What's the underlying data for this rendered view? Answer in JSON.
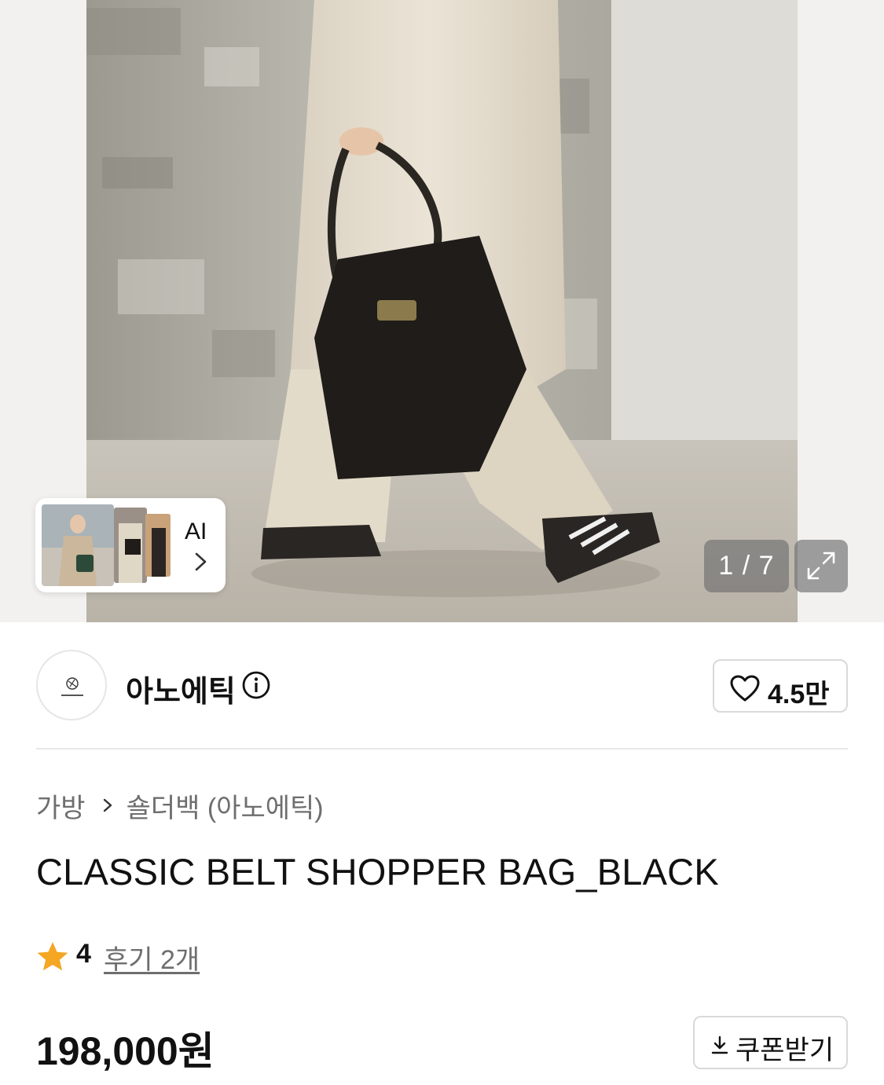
{
  "gallery": {
    "page_current": "1",
    "page_total": "7",
    "page_counter": "1 / 7",
    "thumbnail_label": "AI",
    "icons": {
      "chevron": "chevron-right-icon",
      "expand": "expand-icon"
    }
  },
  "brand": {
    "name": "아노에틱",
    "logo_icon": "brand-logo-icon",
    "info_icon": "info-icon",
    "like_icon": "heart-icon",
    "like_count": "4.5만"
  },
  "breadcrumb": {
    "items": [
      "가방",
      "숄더백 (아노에틱)"
    ]
  },
  "product": {
    "title": "CLASSIC BELT SHOPPER BAG_BLACK",
    "rating": {
      "value": "4",
      "max": 5,
      "star_color": "#F5A623"
    },
    "review_link": "후기 2개",
    "price": "198,000원",
    "coupon_label": "쿠폰받기",
    "coupon_icon": "download-icon"
  }
}
